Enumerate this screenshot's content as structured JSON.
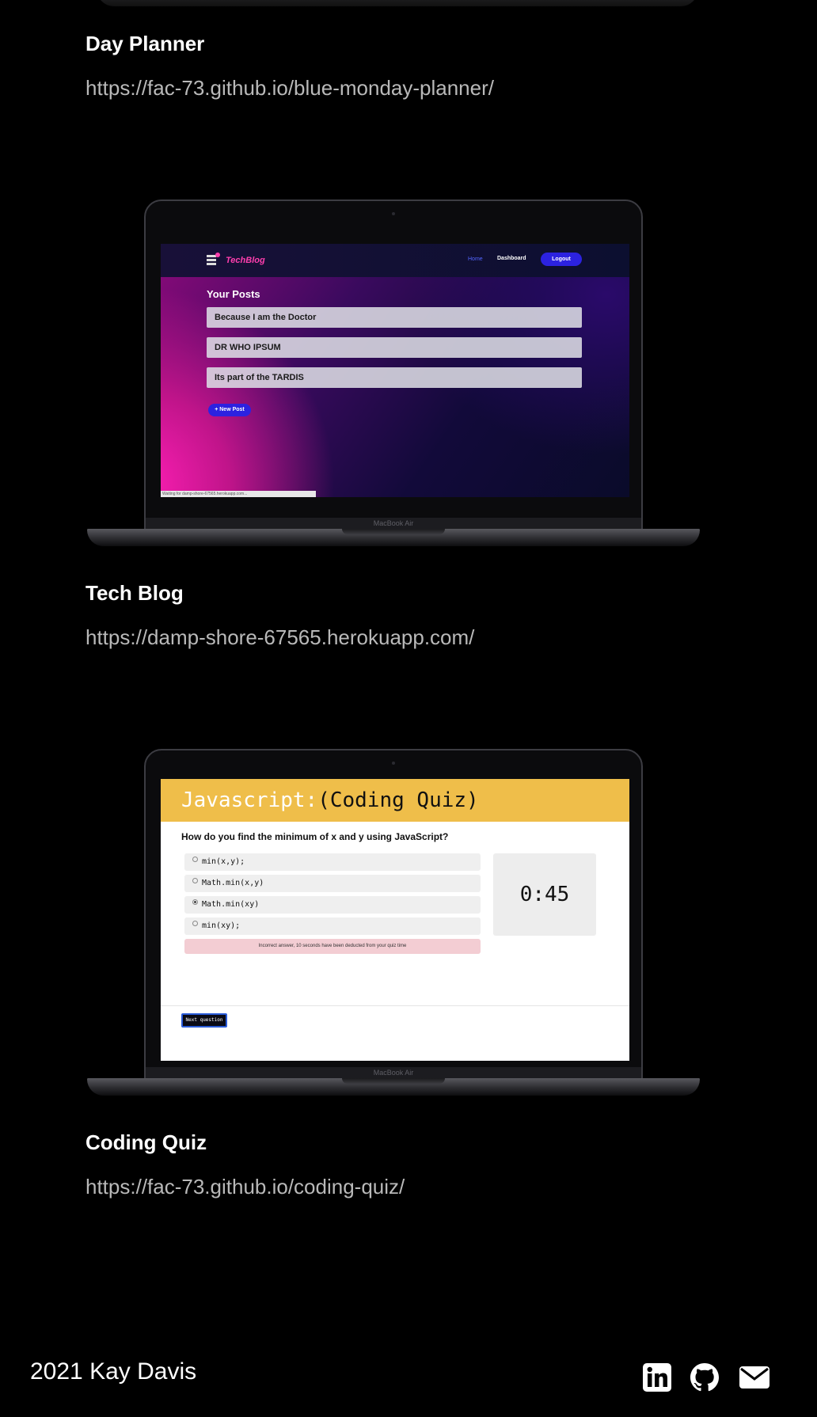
{
  "projects": [
    {
      "title": "Day Planner",
      "link": "https://fac-73.github.io/blue-monday-planner/"
    },
    {
      "title": "Tech Blog",
      "link": "https://damp-shore-67565.herokuapp.com/",
      "screenshot": {
        "logo": "TechBlog",
        "nav": {
          "home": "Home",
          "dashboard": "Dashboard",
          "logout": "Logout"
        },
        "heading": "Your Posts",
        "posts": [
          "Because I am the Doctor",
          "DR WHO IPSUM",
          "Its part of the TARDIS"
        ],
        "new_post": "+ New Post",
        "status": "Waiting for damp-shore-67565.herokuapp.com...",
        "device_label": "MacBook Air"
      }
    },
    {
      "title": "Coding Quiz",
      "link": "https://fac-73.github.io/coding-quiz/",
      "screenshot": {
        "header_part1": "Javascript:",
        "header_part2": "(Coding Quiz)",
        "question": "How do you find the minimum of x and y using JavaScript?",
        "options": [
          "min(x,y);",
          "Math.min(x,y)",
          "Math.min(xy)",
          "min(xy);"
        ],
        "selected_option": 2,
        "feedback": "Incorrect answer, 10 seconds have been deducted from your quiz time",
        "timer": "0:45",
        "next_button": "Next question",
        "device_label": "MacBook Air"
      }
    }
  ],
  "footer": {
    "copyright": "2021 Kay Davis",
    "social": [
      "linkedin-icon",
      "github-icon",
      "envelope-icon"
    ]
  }
}
